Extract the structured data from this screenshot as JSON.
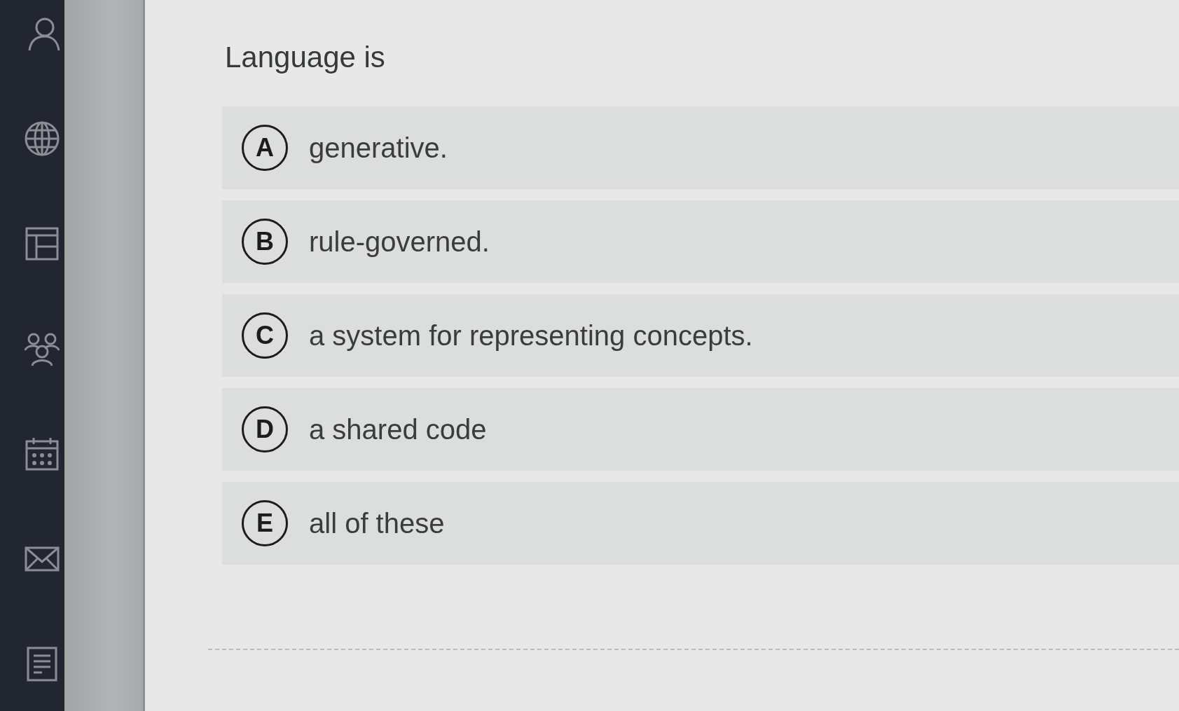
{
  "question": {
    "text": "Language is"
  },
  "options": [
    {
      "letter": "A",
      "text": "generative.",
      "selected": false
    },
    {
      "letter": "B",
      "text": "rule-governed.",
      "selected": false
    },
    {
      "letter": "C",
      "text": "a system for representing concepts.",
      "selected": false
    },
    {
      "letter": "D",
      "text": "a shared code",
      "selected": false
    },
    {
      "letter": "E",
      "text": "all of these",
      "selected": false
    }
  ]
}
